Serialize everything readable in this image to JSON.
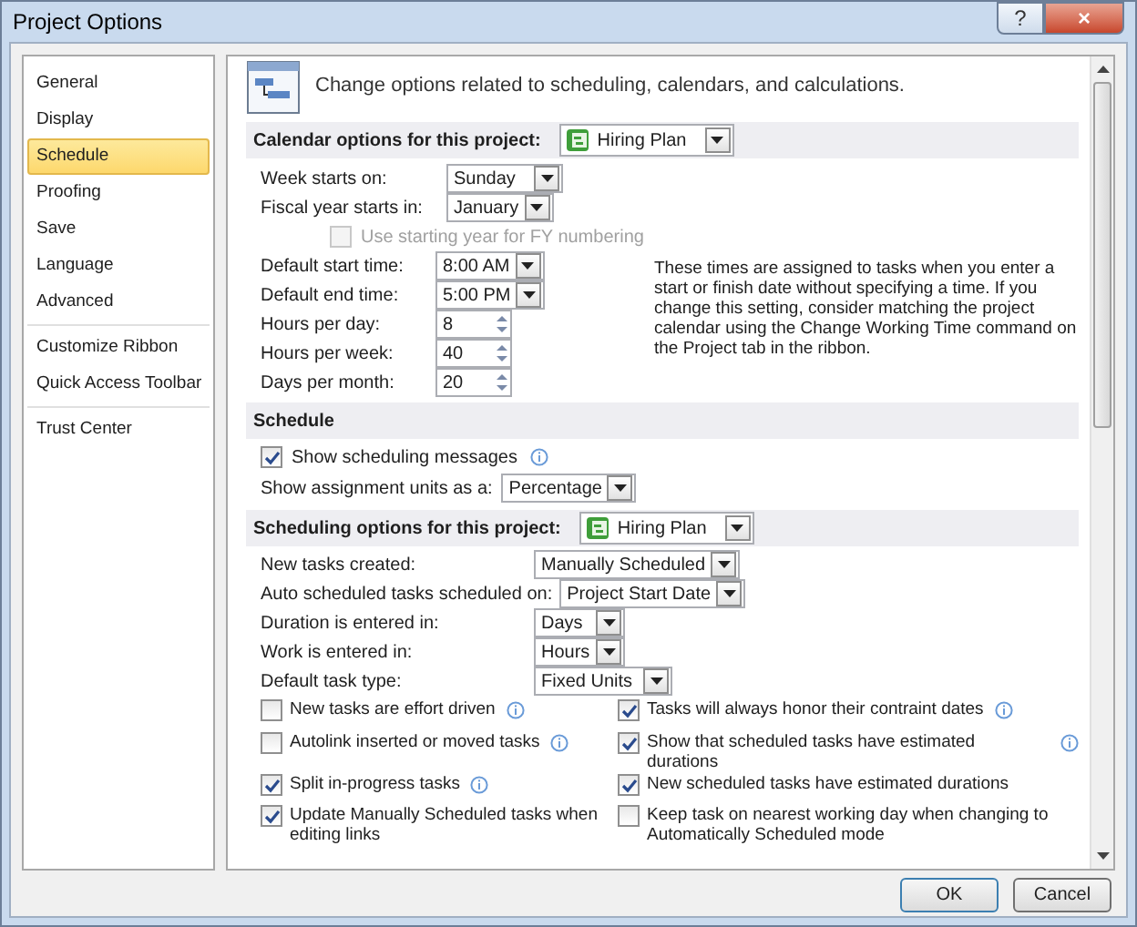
{
  "window": {
    "title": "Project Options",
    "buttons": [
      "?",
      "×"
    ]
  },
  "sidebar": {
    "groups": [
      {
        "items": [
          {
            "label": "General",
            "selected": false
          },
          {
            "label": "Display",
            "selected": false
          },
          {
            "label": "Schedule",
            "selected": true
          },
          {
            "label": "Proofing",
            "selected": false
          },
          {
            "label": "Save",
            "selected": false
          },
          {
            "label": "Language",
            "selected": false
          },
          {
            "label": "Advanced",
            "selected": false
          }
        ]
      },
      {
        "items": [
          {
            "label": "Customize Ribbon",
            "selected": false
          },
          {
            "label": "Quick Access Toolbar",
            "selected": false
          }
        ]
      },
      {
        "items": [
          {
            "label": "Trust Center",
            "selected": false
          }
        ]
      }
    ]
  },
  "header": "Change options related to scheduling, calendars, and calculations.",
  "calendar": {
    "heading": "Calendar options for this project:",
    "project": "Hiring Plan",
    "fields": [
      {
        "kind": "dropdown",
        "label": "Week starts on:",
        "value": "Sunday"
      },
      {
        "kind": "dropdown",
        "label": "Fiscal year starts in:",
        "value": "January"
      },
      {
        "kind": "checkbox",
        "label": "Use starting year for FY numbering",
        "checked": false,
        "disabled": true
      },
      {
        "kind": "dropdown",
        "label": "Default start time:",
        "value": "8:00 AM"
      },
      {
        "kind": "dropdown",
        "label": "Default end time:",
        "value": "5:00 PM"
      },
      {
        "kind": "spin",
        "label": "Hours per day:",
        "value": "8"
      },
      {
        "kind": "spin",
        "label": "Hours per week:",
        "value": "40"
      },
      {
        "kind": "spin",
        "label": "Days per month:",
        "value": "20"
      }
    ],
    "note": "These times are assigned to tasks when you enter a start or finish date without specifying a time. If you change this setting, consider matching the project calendar using the Change Working Time command on the Project tab in the ribbon."
  },
  "schedule": {
    "heading": "Schedule",
    "show_messages": {
      "label": "Show scheduling messages",
      "checked": true,
      "info": true
    },
    "units": {
      "label": "Show assignment units as a:",
      "value": "Percentage"
    }
  },
  "scheduling": {
    "heading": "Scheduling options for this project:",
    "project": "Hiring Plan",
    "fields": [
      {
        "label": "New tasks created:",
        "value": "Manually Scheduled"
      },
      {
        "label": "Auto scheduled tasks scheduled on:",
        "value": "Project Start Date"
      },
      {
        "label": "Duration is entered in:",
        "value": "Days"
      },
      {
        "label": "Work is entered in:",
        "value": "Hours"
      },
      {
        "label": "Default task type:",
        "value": "Fixed Units"
      }
    ],
    "options": [
      {
        "label": "New tasks are effort driven",
        "checked": false,
        "info": true
      },
      {
        "label": "Tasks will always honor their contraint dates",
        "checked": true,
        "info": true
      },
      {
        "label": "Autolink inserted or moved tasks",
        "checked": false,
        "info": true
      },
      {
        "label": "Show that scheduled tasks have estimated durations",
        "checked": true,
        "info": true
      },
      {
        "label": "Split in-progress tasks",
        "checked": true,
        "info": true
      },
      {
        "label": "New scheduled tasks have estimated durations",
        "checked": true,
        "info": false
      },
      {
        "label": "Update Manually Scheduled tasks when editing links",
        "checked": true,
        "info": false
      },
      {
        "label": "Keep task on nearest working day when changing to Automatically Scheduled mode",
        "checked": false,
        "info": false
      }
    ]
  },
  "footer": {
    "buttons": [
      "OK",
      "Cancel"
    ]
  }
}
